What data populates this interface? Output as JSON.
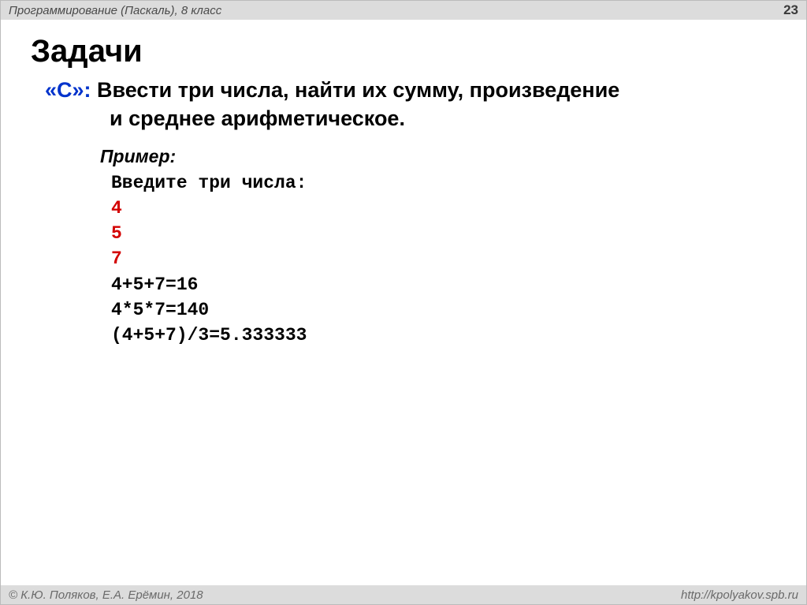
{
  "header": {
    "course": "Программирование (Паскаль), 8 класс",
    "page": "23"
  },
  "title": "Задачи",
  "task": {
    "label": "«С»:",
    "text_line1": " Ввести три числа, найти их сумму, произведение",
    "text_line2": "и среднее арифметическое."
  },
  "example": {
    "label": "Пример:",
    "prompt": "Введите три числа:",
    "v1": "4",
    "v2": "5",
    "v3": "7",
    "sum": "4+5+7=16",
    "prod": "4*5*7=140",
    "avg": "(4+5+7)/3=5.333333"
  },
  "footer": {
    "copyright": "© К.Ю. Поляков, Е.А. Ерёмин, 2018",
    "url": "http://kpolyakov.spb.ru"
  }
}
